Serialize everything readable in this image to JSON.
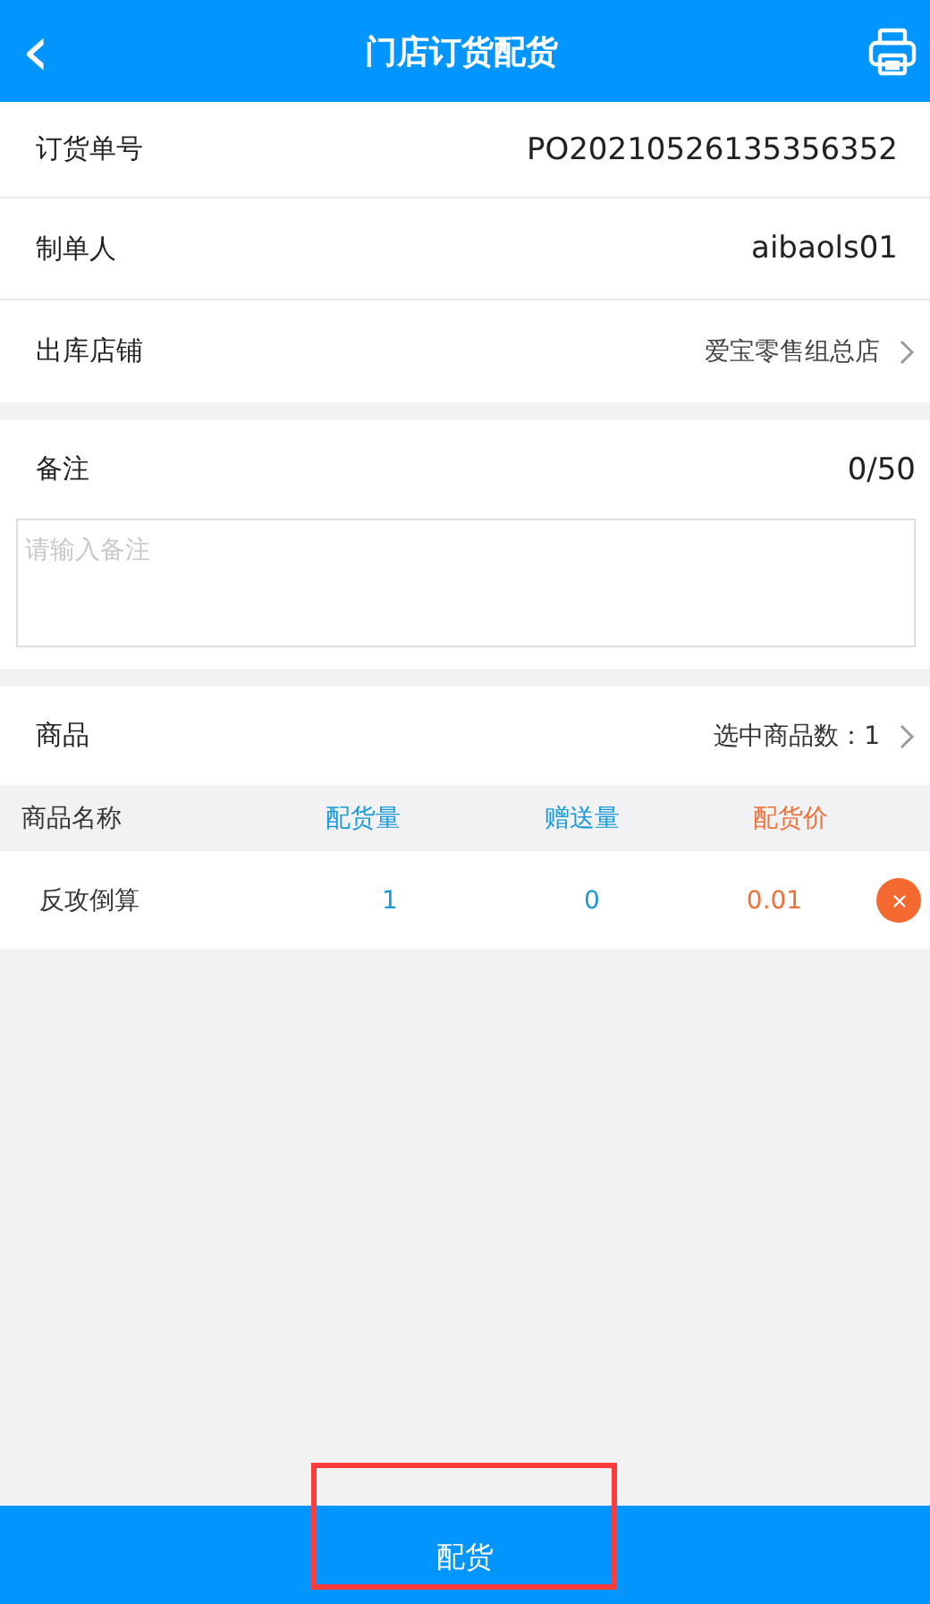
{
  "header": {
    "back_icon": "‹",
    "title": "门店订货配货"
  },
  "info_rows": [
    {
      "label": "订货单号",
      "value": "PO20210526135356352",
      "has_arrow": false
    },
    {
      "label": "制单人",
      "value": "aibaols01",
      "has_arrow": false
    },
    {
      "label": "出库店铺",
      "value": "爱宝零售组总店",
      "has_arrow": true
    }
  ],
  "remark": {
    "label": "备注",
    "counter": "0/50",
    "placeholder": "请输入备注"
  },
  "goods": {
    "label": "商品",
    "summary": "选中商品数：1"
  },
  "table": {
    "columns": [
      {
        "label": "商品名称",
        "color": "#333333"
      },
      {
        "label": "配货量",
        "color": "#1a9bd7"
      },
      {
        "label": "赠送量",
        "color": "#1a9bd7"
      },
      {
        "label": "配货价",
        "color": "#f0703a"
      }
    ],
    "rows": [
      {
        "name": "反攻倒算",
        "qty": "1",
        "gift": "0",
        "price": "0.01"
      }
    ]
  },
  "footer": {
    "button": "配货",
    "highlighted": true
  }
}
